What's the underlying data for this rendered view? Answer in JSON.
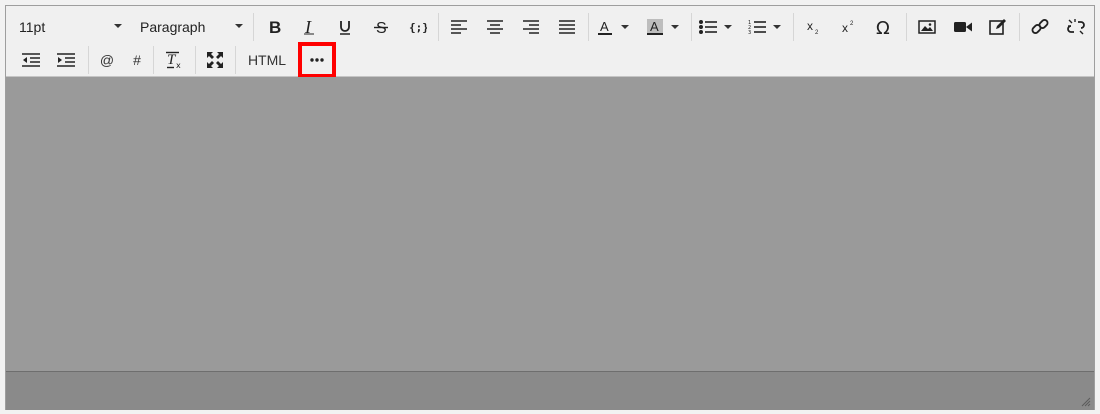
{
  "toolbar": {
    "font_size": "11pt",
    "block_format": "Paragraph",
    "html_label": "HTML",
    "at_label": "@",
    "hash_label": "#",
    "icons": {
      "bold": "bold-icon",
      "italic": "italic-icon",
      "underline": "underline-icon",
      "strikethrough": "strikethrough-icon",
      "code": "code-icon",
      "align_left": "align-left-icon",
      "align_center": "align-center-icon",
      "align_right": "align-right-icon",
      "justify": "justify-icon",
      "text_color": "text-color-icon",
      "background_color": "background-color-icon",
      "bullet_list": "bullet-list-icon",
      "numbered_list": "numbered-list-icon",
      "subscript": "subscript-icon",
      "superscript": "superscript-icon",
      "special_char": "omega-icon",
      "image": "image-icon",
      "media": "video-icon",
      "edit": "edit-icon",
      "link": "link-icon",
      "unlink": "unlink-icon",
      "outdent": "outdent-icon",
      "indent": "indent-icon",
      "clear_format": "clear-formatting-icon",
      "fullscreen": "fullscreen-icon",
      "more": "more-icon"
    }
  },
  "colors": {
    "toolbar_bg": "#f0f0f0",
    "content_bg": "#9a9a9a",
    "statusbar_bg": "#8a8a8a",
    "highlight": "#ff0000"
  }
}
